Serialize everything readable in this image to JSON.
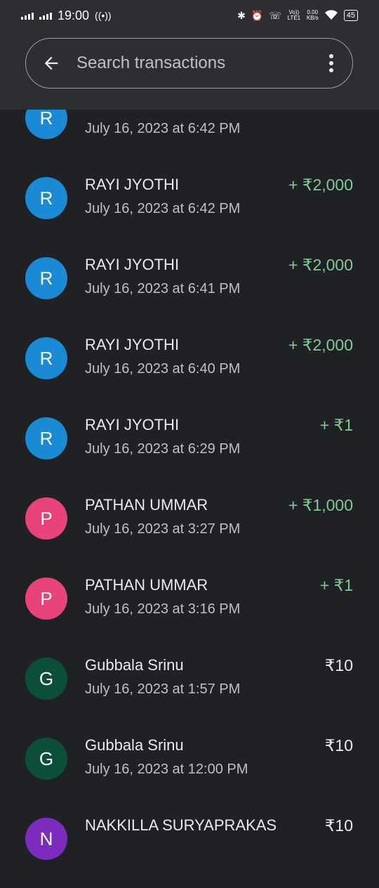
{
  "status_bar": {
    "time": "19:00",
    "net_speed_value": "0.00",
    "net_speed_unit": "KB/s",
    "battery": "45",
    "volte": "Vo)) LTE1"
  },
  "search": {
    "placeholder": "Search transactions"
  },
  "transactions": [
    {
      "initial": "R",
      "color": "#1a8ad4",
      "name": "",
      "date": "July 16, 2023 at 6:42 PM",
      "amount": "",
      "positive": true
    },
    {
      "initial": "R",
      "color": "#1a8ad4",
      "name": "RAYI JYOTHI",
      "date": "July 16, 2023 at 6:42 PM",
      "amount": "+ ₹2,000",
      "positive": true
    },
    {
      "initial": "R",
      "color": "#1a8ad4",
      "name": "RAYI JYOTHI",
      "date": "July 16, 2023 at 6:41 PM",
      "amount": "+ ₹2,000",
      "positive": true
    },
    {
      "initial": "R",
      "color": "#1a8ad4",
      "name": "RAYI JYOTHI",
      "date": "July 16, 2023 at 6:40 PM",
      "amount": "+ ₹2,000",
      "positive": true
    },
    {
      "initial": "R",
      "color": "#1a8ad4",
      "name": "RAYI JYOTHI",
      "date": "July 16, 2023 at 6:29 PM",
      "amount": "+ ₹1",
      "positive": true
    },
    {
      "initial": "P",
      "color": "#e8437b",
      "name": "PATHAN UMMAR",
      "date": "July 16, 2023 at 3:27 PM",
      "amount": "+ ₹1,000",
      "positive": true
    },
    {
      "initial": "P",
      "color": "#e8437b",
      "name": "PATHAN UMMAR",
      "date": "July 16, 2023 at 3:16 PM",
      "amount": "+ ₹1",
      "positive": true
    },
    {
      "initial": "G",
      "color": "#0b4f3b",
      "name": "Gubbala Srinu",
      "date": "July 16, 2023 at 1:57 PM",
      "amount": "₹10",
      "positive": false
    },
    {
      "initial": "G",
      "color": "#0b4f3b",
      "name": "Gubbala Srinu",
      "date": "July 16, 2023 at 12:00 PM",
      "amount": "₹10",
      "positive": false
    },
    {
      "initial": "N",
      "color": "#7b2cbf",
      "name": "NAKKILLA SURYAPRAKAS",
      "date": "",
      "amount": "₹10",
      "positive": false
    }
  ]
}
